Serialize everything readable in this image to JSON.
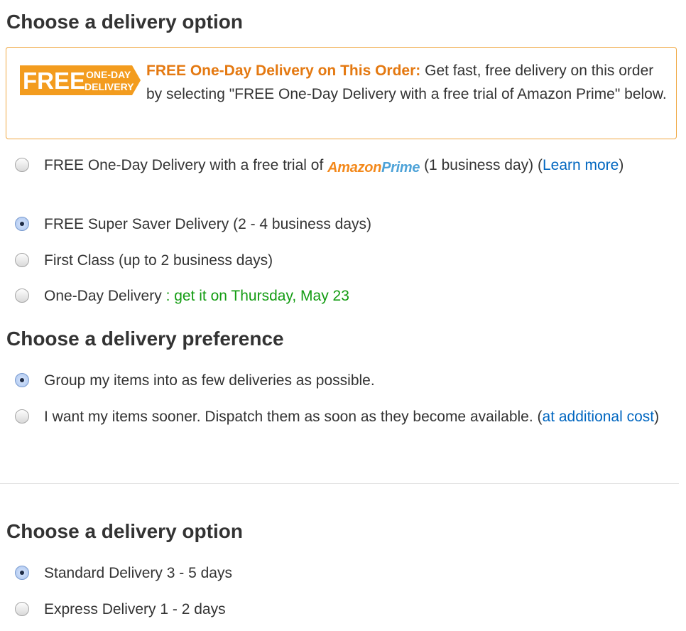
{
  "delivery_option_section": {
    "heading": "Choose a delivery option",
    "promo": {
      "badge": {
        "free": "FREE",
        "line1": "ONE-DAY",
        "line2": "DELIVERY"
      },
      "headline": "FREE One-Day Delivery on This Order:",
      "body": "Get fast, free delivery on this order by selecting \"FREE One-Day Delivery with a free trial of Amazon Prime\" below."
    },
    "options": [
      {
        "label_before": "FREE One-Day Delivery with a free trial of",
        "logo_amazon": "Amazon",
        "logo_prime": "Prime",
        "label_after": "(1 business day) (",
        "link": "Learn more",
        "closing": ")",
        "selected": false
      },
      {
        "label": "FREE Super Saver Delivery (2 - 4 business days)",
        "selected": true
      },
      {
        "label": "First Class (up to 2 business days)",
        "selected": false
      },
      {
        "label": "One-Day Delivery",
        "note": ": get it on Thursday, May 23",
        "selected": false
      }
    ]
  },
  "delivery_preference_section": {
    "heading": "Choose a delivery preference",
    "options": [
      {
        "label": "Group my items into as few deliveries as possible.",
        "selected": true
      },
      {
        "label": "I want my items sooner. Dispatch them as soon as they become available. (",
        "link": "at additional cost",
        "closing": ")",
        "selected": false
      }
    ]
  },
  "second_delivery_option_section": {
    "heading": "Choose a delivery option",
    "options": [
      {
        "label": "Standard Delivery 3 - 5 days",
        "selected": true
      },
      {
        "label": "Express Delivery 1 - 2 days",
        "selected": false
      }
    ]
  },
  "colors": {
    "promo_orange": "#e47911",
    "promo_border": "#f0a843",
    "link_blue": "#0066c0",
    "date_green": "#139c12",
    "text_dark": "#333333"
  }
}
